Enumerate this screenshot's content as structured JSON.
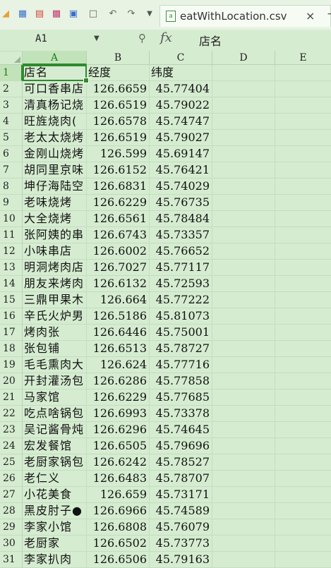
{
  "toolbar": {
    "icons": [
      "folder-open-icon",
      "save-icon",
      "export-pdf-icon",
      "print-icon",
      "print-preview-icon",
      "page-preview-icon",
      "undo-icon",
      "redo-icon",
      "dropdown-icon"
    ],
    "tab": {
      "title": "eatWithLocation.csv",
      "close": "×",
      "more": "−"
    }
  },
  "formula_bar": {
    "cell_ref": "A1",
    "content": "店名"
  },
  "columns": [
    "A",
    "B",
    "C",
    "D",
    "E"
  ],
  "rows": [
    {
      "n": "1",
      "name": "店名",
      "lng": "经度",
      "lat": "纬度"
    },
    {
      "n": "2",
      "name": "可口香串店",
      "lng": "126.6659",
      "lat": "45.77404"
    },
    {
      "n": "3",
      "name": "清真杨记烧",
      "lng": "126.6519",
      "lat": "45.79022"
    },
    {
      "n": "4",
      "name": "旺旌烧肉(",
      "lng": "126.6578",
      "lat": "45.74747"
    },
    {
      "n": "5",
      "name": "老太太烧烤",
      "lng": "126.6519",
      "lat": "45.79027"
    },
    {
      "n": "6",
      "name": "金刚山烧烤",
      "lng": "126.599",
      "lat": "45.69147"
    },
    {
      "n": "7",
      "name": "胡同里京味",
      "lng": "126.6152",
      "lat": "45.76421"
    },
    {
      "n": "8",
      "name": "坤仔海陆空",
      "lng": "126.6831",
      "lat": "45.74029"
    },
    {
      "n": "9",
      "name": "老味烧烤",
      "lng": "126.6229",
      "lat": "45.76735"
    },
    {
      "n": "10",
      "name": "大全烧烤",
      "lng": "126.6561",
      "lat": "45.78484"
    },
    {
      "n": "11",
      "name": "张阿姨的串",
      "lng": "126.6743",
      "lat": "45.73357"
    },
    {
      "n": "12",
      "name": "小味串店",
      "lng": "126.6002",
      "lat": "45.76652"
    },
    {
      "n": "13",
      "name": "明洞烤肉店",
      "lng": "126.7027",
      "lat": "45.77117"
    },
    {
      "n": "14",
      "name": "朋友来烤肉",
      "lng": "126.6132",
      "lat": "45.72593"
    },
    {
      "n": "15",
      "name": "三鼎甲果木",
      "lng": "126.664",
      "lat": "45.77222"
    },
    {
      "n": "16",
      "name": "辛氏火炉男",
      "lng": "126.5186",
      "lat": "45.81073"
    },
    {
      "n": "17",
      "name": "烤肉张",
      "lng": "126.6446",
      "lat": "45.75001"
    },
    {
      "n": "18",
      "name": "张包铺",
      "lng": "126.6513",
      "lat": "45.78727"
    },
    {
      "n": "19",
      "name": "毛毛熏肉大",
      "lng": "126.624",
      "lat": "45.77716"
    },
    {
      "n": "20",
      "name": "开封灌汤包",
      "lng": "126.6286",
      "lat": "45.77858"
    },
    {
      "n": "21",
      "name": "马家馆",
      "lng": "126.6229",
      "lat": "45.77685"
    },
    {
      "n": "22",
      "name": "吃点啥锅包",
      "lng": "126.6993",
      "lat": "45.73378"
    },
    {
      "n": "23",
      "name": "吴记酱骨炖",
      "lng": "126.6296",
      "lat": "45.74645"
    },
    {
      "n": "24",
      "name": "宏发餐馆",
      "lng": "126.6505",
      "lat": "45.79696"
    },
    {
      "n": "25",
      "name": "老厨家锅包",
      "lng": "126.6242",
      "lat": "45.78527"
    },
    {
      "n": "26",
      "name": "老仁义",
      "lng": "126.6483",
      "lat": "45.78707"
    },
    {
      "n": "27",
      "name": "小花美食",
      "lng": "126.659",
      "lat": "45.73171"
    },
    {
      "n": "28",
      "name": "黑皮肘子●",
      "lng": "126.6966",
      "lat": "45.74589"
    },
    {
      "n": "29",
      "name": "李家小馆",
      "lng": "126.6808",
      "lat": "45.76079"
    },
    {
      "n": "30",
      "name": "老厨家",
      "lng": "126.6502",
      "lat": "45.73773"
    },
    {
      "n": "31",
      "name": "李家扒肉",
      "lng": "126.6506",
      "lat": "45.79163"
    }
  ]
}
